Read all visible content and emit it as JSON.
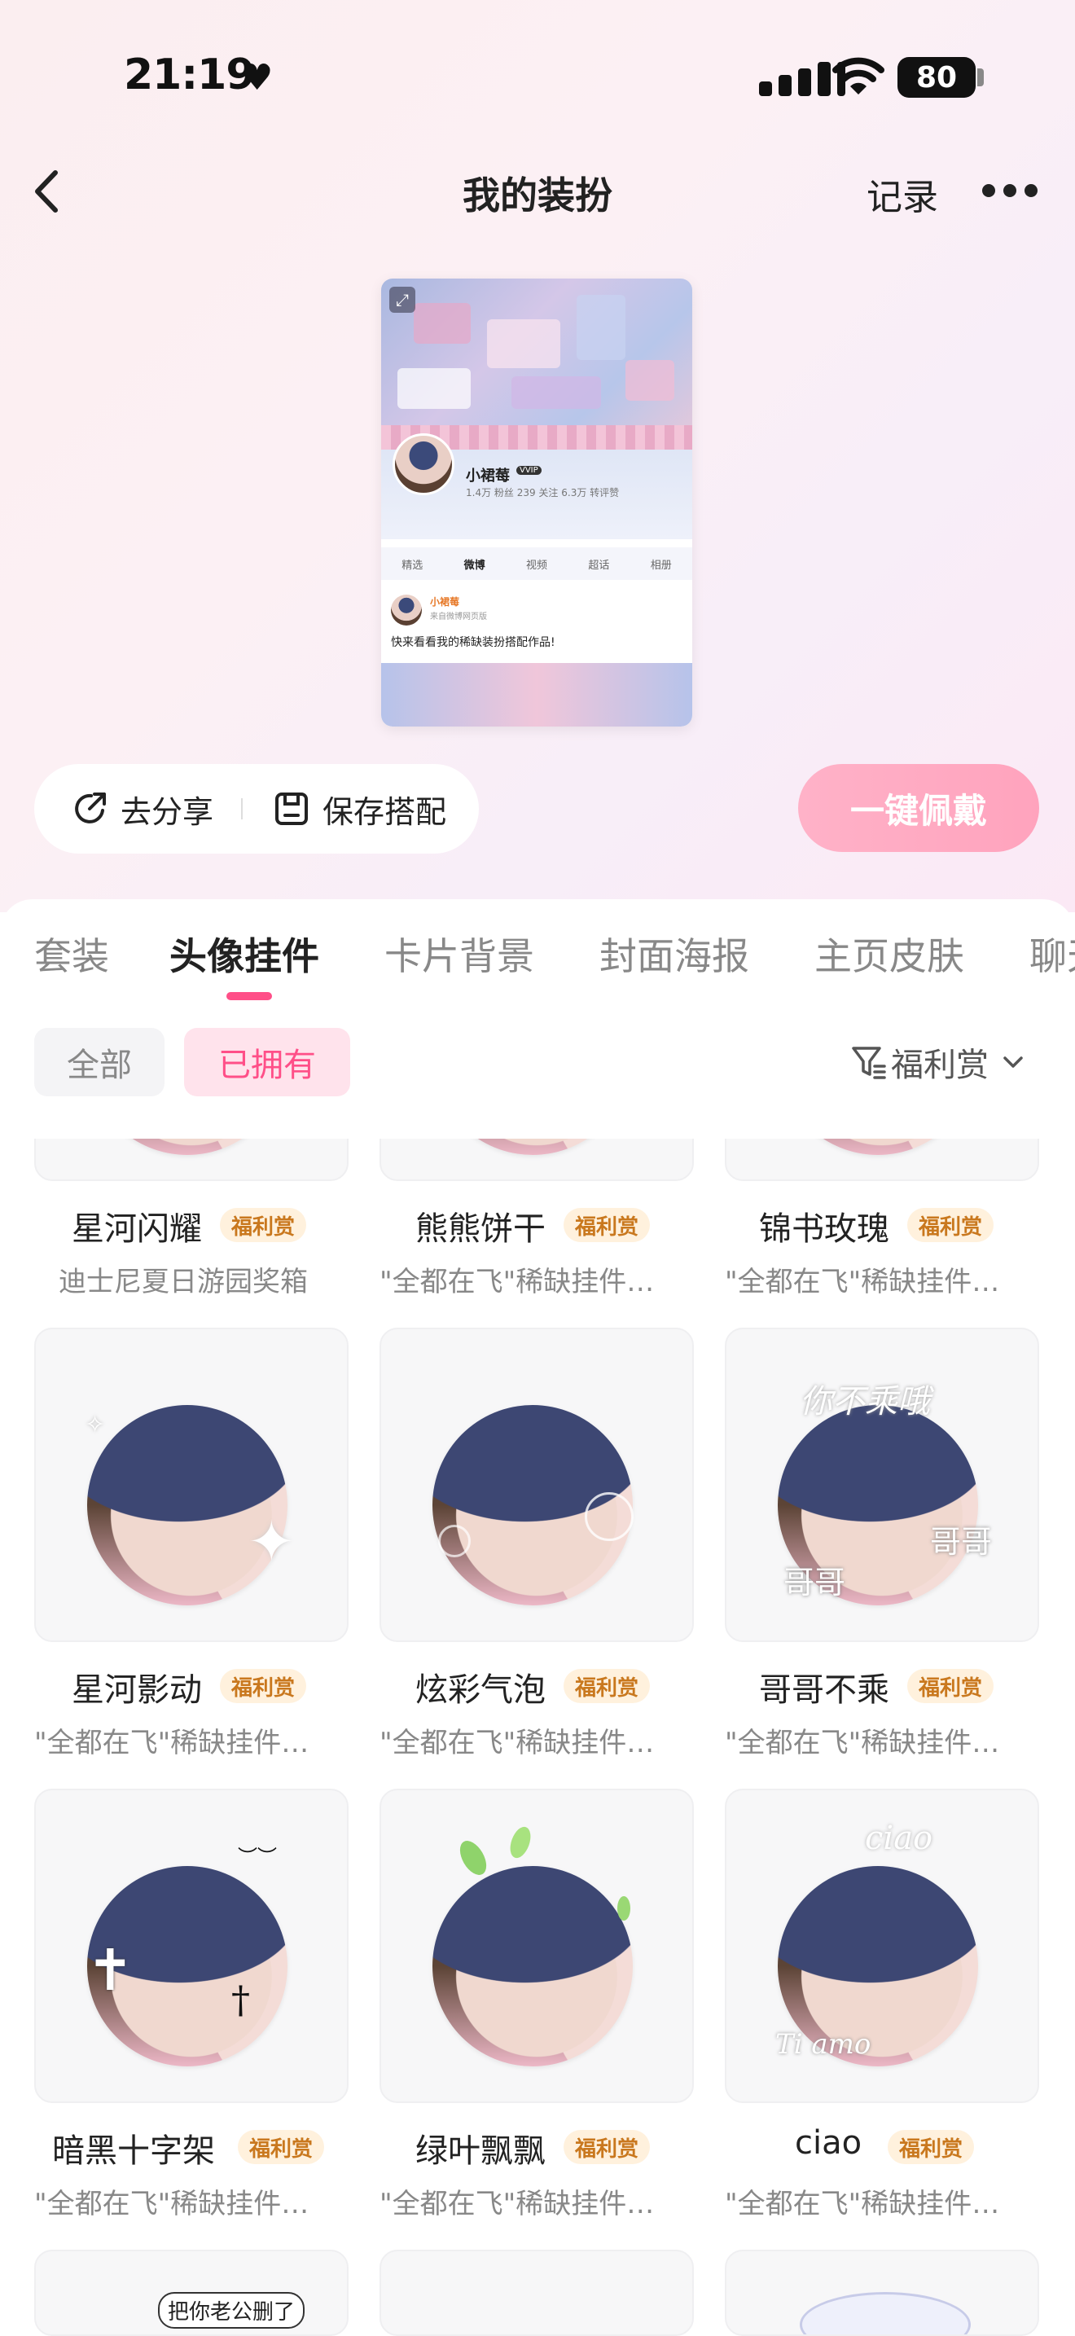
{
  "status": {
    "time": "21:19",
    "battery": "80"
  },
  "nav": {
    "title": "我的装扮",
    "record": "记录"
  },
  "preview": {
    "name": "小裙莓",
    "vip": "VVIP",
    "stats": "1.4万 粉丝   239 关注   6.3万 转评赞",
    "tabs": [
      "精选",
      "微博",
      "视频",
      "超话",
      "相册"
    ],
    "post_name": "小裙莓",
    "post_sub": "来自微博网页版",
    "post_text": "快来看看我的稀缺装扮搭配作品!"
  },
  "actions": {
    "share": "去分享",
    "save": "保存搭配",
    "wear": "一键佩戴"
  },
  "tabs": [
    "套装",
    "头像挂件",
    "卡片背景",
    "封面海报",
    "主页皮肤",
    "聊天"
  ],
  "filters": {
    "all": "全部",
    "owned": "已拥有",
    "sort": "福利赏"
  },
  "items": [
    {
      "name": "星河闪耀",
      "badge": "福利赏",
      "desc": "迪士尼夏日游园奖箱"
    },
    {
      "name": "熊熊饼干",
      "badge": "福利赏",
      "desc": "\"全都在飞\"稀缺挂件…"
    },
    {
      "name": "锦书玫瑰",
      "badge": "福利赏",
      "desc": "\"全都在飞\"稀缺挂件…"
    },
    {
      "name": "星河影动",
      "badge": "福利赏",
      "desc": "\"全都在飞\"稀缺挂件…"
    },
    {
      "name": "炫彩气泡",
      "badge": "福利赏",
      "desc": "\"全都在飞\"稀缺挂件…"
    },
    {
      "name": "哥哥不乘",
      "badge": "福利赏",
      "desc": "\"全都在飞\"稀缺挂件…"
    },
    {
      "name": "暗黑十字架",
      "badge": "福利赏",
      "desc": "\"全都在飞\"稀缺挂件…"
    },
    {
      "name": "绿叶飘飘",
      "badge": "福利赏",
      "desc": "\"全都在飞\"稀缺挂件…"
    },
    {
      "name": "ciao",
      "badge": "福利赏",
      "desc": "\"全都在飞\"稀缺挂件…"
    }
  ],
  "decorations": {
    "bubble_text": "你不乘哦",
    "gege": "哥哥",
    "ciao_script": "ciao",
    "tiamo": "Ti amo",
    "last_row_text": "把你老公删了"
  },
  "colors": {
    "accent": "#ff4f88",
    "badge_bg": "#fff1dd",
    "badge_text": "#c9781e",
    "wear_btn": "#ffaac2"
  }
}
